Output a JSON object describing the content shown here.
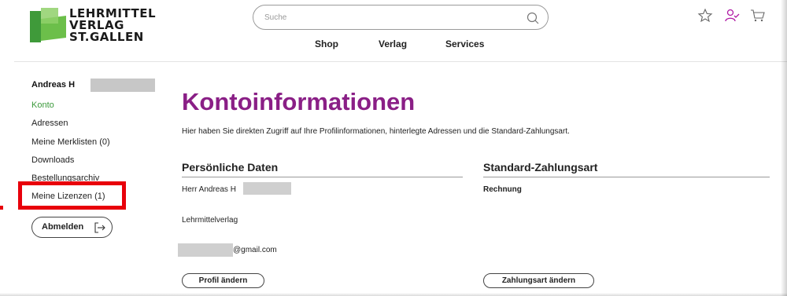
{
  "logo": {
    "lines": [
      "LEHRMITTEL",
      "VERLAG",
      "ST.GALLEN"
    ]
  },
  "search": {
    "placeholder": "Suche",
    "value": ""
  },
  "topnav": {
    "shop": "Shop",
    "verlag": "Verlag",
    "services": "Services"
  },
  "header_icons": [
    "star-icon",
    "user-check-icon",
    "cart-icon"
  ],
  "colors": {
    "title": "#8a1f86",
    "active_link": "#3c9a3c",
    "highlight": "#e8000b",
    "logo_green": "#3f9a3a"
  },
  "sidebar": {
    "user_name": "Andreas H",
    "items": [
      {
        "label": "Konto",
        "active": true
      },
      {
        "label": "Adressen",
        "active": false
      },
      {
        "label": "Meine Merklisten (0)",
        "active": false
      },
      {
        "label": "Downloads",
        "active": false
      },
      {
        "label": "Bestellungsarchiv",
        "active": false
      },
      {
        "label": "Meine Lizenzen (1)",
        "active": false
      }
    ],
    "logout_label": "Abmelden"
  },
  "main": {
    "title": "Kontoinformationen",
    "intro": "Hier haben Sie direkten Zugriff auf Ihre Profilinformationen, hinterlegte Adressen und die Standard-Zahlungsart.",
    "personal": {
      "title": "Persönliche Daten",
      "name": "Herr Andreas H",
      "company": "Lehrmittelverlag",
      "email": "@gmail.com",
      "button": "Profil ändern"
    },
    "payment": {
      "title": "Standard-Zahlungsart",
      "method": "Rechnung",
      "button": "Zahlungsart ändern"
    }
  }
}
